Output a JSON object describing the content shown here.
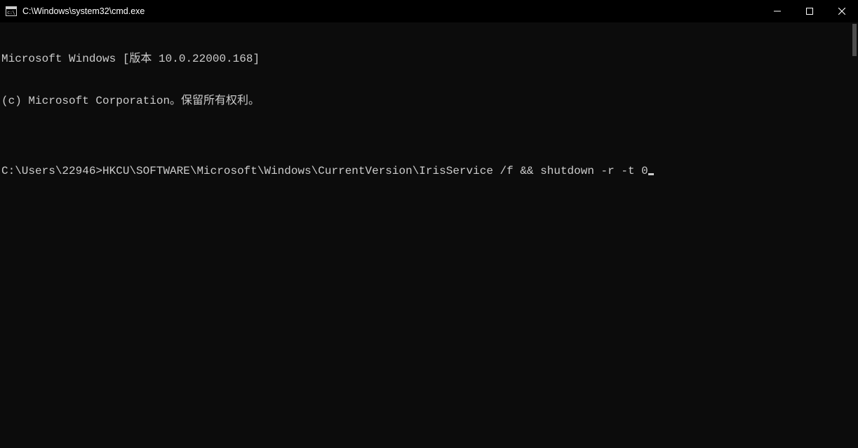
{
  "window": {
    "title": "C:\\Windows\\system32\\cmd.exe"
  },
  "terminal": {
    "line1": "Microsoft Windows [版本 10.0.22000.168]",
    "line2": "(c) Microsoft Corporation。保留所有权利。",
    "blank": "",
    "prompt": "C:\\Users\\22946>",
    "command": "HKCU\\SOFTWARE\\Microsoft\\Windows\\CurrentVersion\\IrisService /f && shutdown -r -t 0"
  }
}
